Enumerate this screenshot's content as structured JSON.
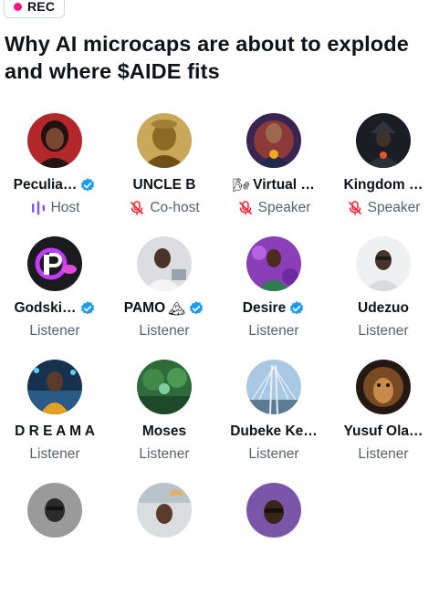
{
  "badge": {
    "label": "REC"
  },
  "title": "Why AI microcaps are about to explode and where $AIDE fits",
  "participants": [
    {
      "name": "Peculia…",
      "role": "Host"
    },
    {
      "name": "UNCLE B",
      "role": "Co-host"
    },
    {
      "name": "Virtual …",
      "role": "Speaker"
    },
    {
      "name": "Kingdom …",
      "role": "Speaker"
    },
    {
      "name": "Godski…",
      "role": "Listener"
    },
    {
      "name": "PAMO",
      "role": "Listener"
    },
    {
      "name": "Desire",
      "role": "Listener"
    },
    {
      "name": "Udezuo",
      "role": "Listener"
    },
    {
      "name": "D R E A M A",
      "role": "Listener"
    },
    {
      "name": "Moses",
      "role": "Listener"
    },
    {
      "name": "Dubeke Ke…",
      "role": "Listener"
    },
    {
      "name": "Yusuf Ola…",
      "role": "Listener"
    },
    {
      "name": "",
      "role": ""
    },
    {
      "name": "",
      "role": ""
    },
    {
      "name": "",
      "role": ""
    }
  ],
  "colors": {
    "accent": "#1d9bf0",
    "rec": "#f91880",
    "host_purple": "#7856ff",
    "muted_red": "#f4212e",
    "secondary_text": "#536471"
  },
  "icons": {
    "verified": "verified-badge-icon",
    "host": "audio-wave-icon",
    "muted": "mic-off-icon",
    "virtual_emoji": "pinwheel-emoji",
    "pamo_emoji": "mountain-emoji"
  }
}
